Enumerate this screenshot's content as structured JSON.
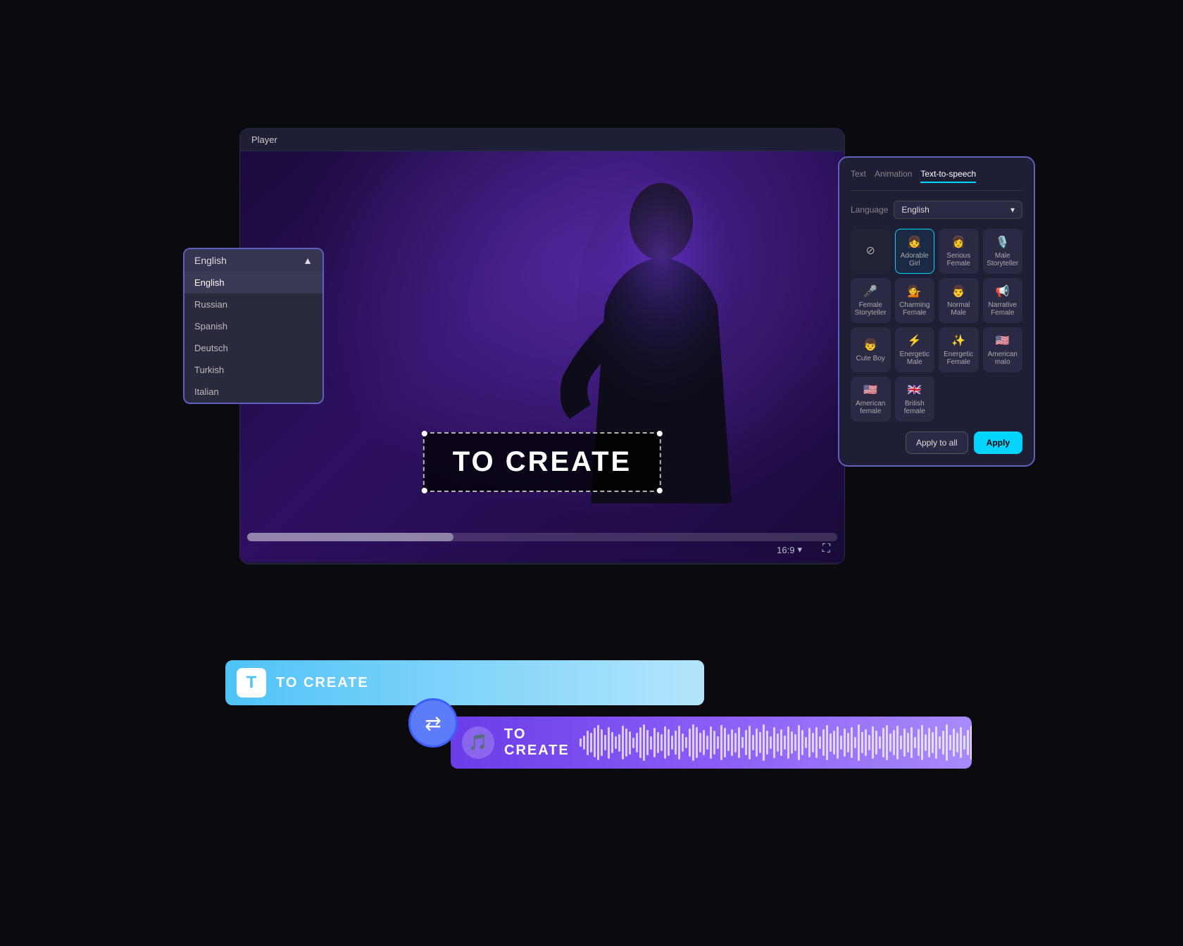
{
  "player": {
    "title": "Player",
    "ratio": "16:9"
  },
  "video_text": "TO CREATE",
  "language_dropdown": {
    "selected": "English",
    "options": [
      "English",
      "Russian",
      "Spanish",
      "Deutsch",
      "Turkish",
      "Italian"
    ]
  },
  "tts_panel": {
    "tabs": [
      "Text",
      "Animation",
      "Text-to-speech"
    ],
    "active_tab": "Text-to-speech",
    "language_label": "Language",
    "language_value": "English",
    "voices": [
      {
        "name": "",
        "type": "muted",
        "icon": "⊘"
      },
      {
        "name": "Adorable Girl",
        "type": "selected",
        "icon": "👧"
      },
      {
        "name": "Serious Female",
        "type": "normal",
        "icon": "👩"
      },
      {
        "name": "Male Storyteller",
        "type": "normal",
        "icon": "👨"
      },
      {
        "name": "Female Storyteller",
        "type": "normal",
        "icon": "🎙️"
      },
      {
        "name": "Charming Female",
        "type": "normal",
        "icon": "💁"
      },
      {
        "name": "Normal Male",
        "type": "normal",
        "icon": "🎤"
      },
      {
        "name": "Narrative Female",
        "type": "normal",
        "icon": "📢"
      },
      {
        "name": "Cute Boy",
        "type": "normal",
        "icon": "👦"
      },
      {
        "name": "Energetic Male",
        "type": "normal",
        "icon": "⚡"
      },
      {
        "name": "Energetic Female",
        "type": "normal",
        "icon": "✨"
      },
      {
        "name": "American malo",
        "type": "normal",
        "icon": "🇺🇸"
      },
      {
        "name": "American female",
        "type": "normal",
        "icon": "🇺🇸"
      },
      {
        "name": "British female",
        "type": "normal",
        "icon": "🇬🇧"
      }
    ],
    "apply_all_label": "Apply to all",
    "apply_label": "Apply"
  },
  "bottom_tracks": {
    "text_track_label": "TO CREATE",
    "audio_track_label": "TO CREATE"
  },
  "wave_heights": [
    12,
    20,
    35,
    28,
    42,
    50,
    38,
    22,
    45,
    30,
    18,
    25,
    48,
    40,
    33,
    15,
    28,
    44,
    52,
    36,
    19,
    42,
    30,
    24,
    46,
    38,
    20,
    34,
    48,
    26,
    16,
    40,
    52,
    44,
    28,
    36,
    20,
    46,
    34,
    18,
    50,
    42,
    24,
    38,
    28,
    44,
    16,
    36,
    48,
    22,
    40,
    30,
    52,
    34,
    18,
    44,
    26,
    38,
    20,
    46,
    32,
    24,
    50,
    36,
    16,
    42,
    28,
    44,
    18,
    38,
    50,
    26,
    34,
    46,
    20,
    40,
    28,
    44,
    16,
    52,
    30,
    38,
    22,
    46,
    34,
    18,
    42,
    50,
    26,
    36,
    48,
    20,
    40,
    28,
    44,
    16,
    38,
    50,
    24,
    42,
    30,
    46,
    18,
    34,
    52,
    22,
    40,
    28,
    44,
    20,
    36,
    48,
    16,
    42,
    30
  ]
}
